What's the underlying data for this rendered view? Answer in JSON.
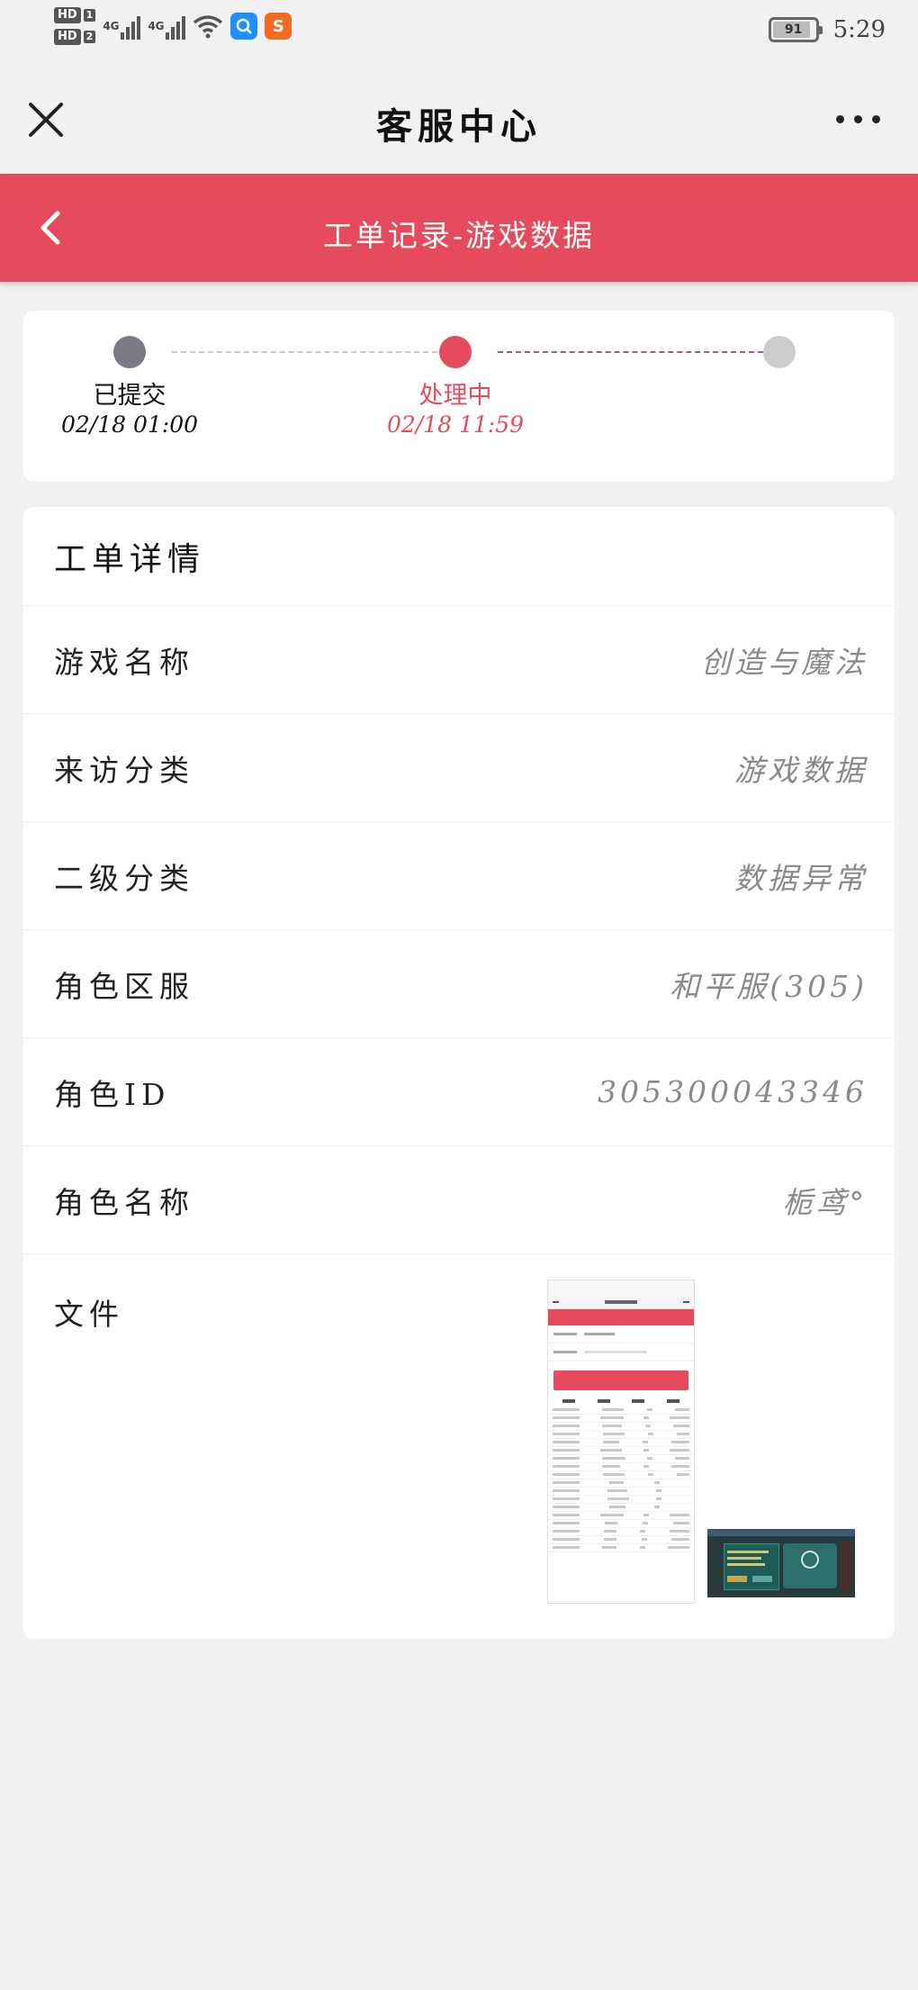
{
  "status_bar": {
    "sim1": "HD",
    "sim1_num": "1",
    "sim2": "HD",
    "sim2_num": "2",
    "network1": "4G",
    "network2": "4G",
    "battery_level": "91",
    "time": "5:29",
    "app_icons": [
      "search-app-icon",
      "sogou-app-icon"
    ]
  },
  "title_bar": {
    "title": "客服中心"
  },
  "header": {
    "title": "工单记录-游戏数据"
  },
  "progress": {
    "steps": [
      {
        "label": "已提交",
        "time": "02/18 01:00",
        "color": "#7a7a85"
      },
      {
        "label": "处理中",
        "time": "02/18 11:59",
        "color": "#e64b5d"
      },
      {
        "label": "",
        "time": "",
        "color": "#cccccc"
      }
    ]
  },
  "details": {
    "heading": "工单详情",
    "rows": [
      {
        "key": "游戏名称",
        "value": "创造与魔法"
      },
      {
        "key": "来访分类",
        "value": "游戏数据"
      },
      {
        "key": "二级分类",
        "value": "数据异常"
      },
      {
        "key": "角色区服",
        "value": "和平服(305)"
      },
      {
        "key": "角色ID",
        "value": "305300043346"
      },
      {
        "key": "角色名称",
        "value": "栀鸢°"
      }
    ],
    "file_label": "文件"
  },
  "colors": {
    "accent": "#e64b5d",
    "background": "#f1f1f1",
    "value_text": "#8a8a8a"
  }
}
